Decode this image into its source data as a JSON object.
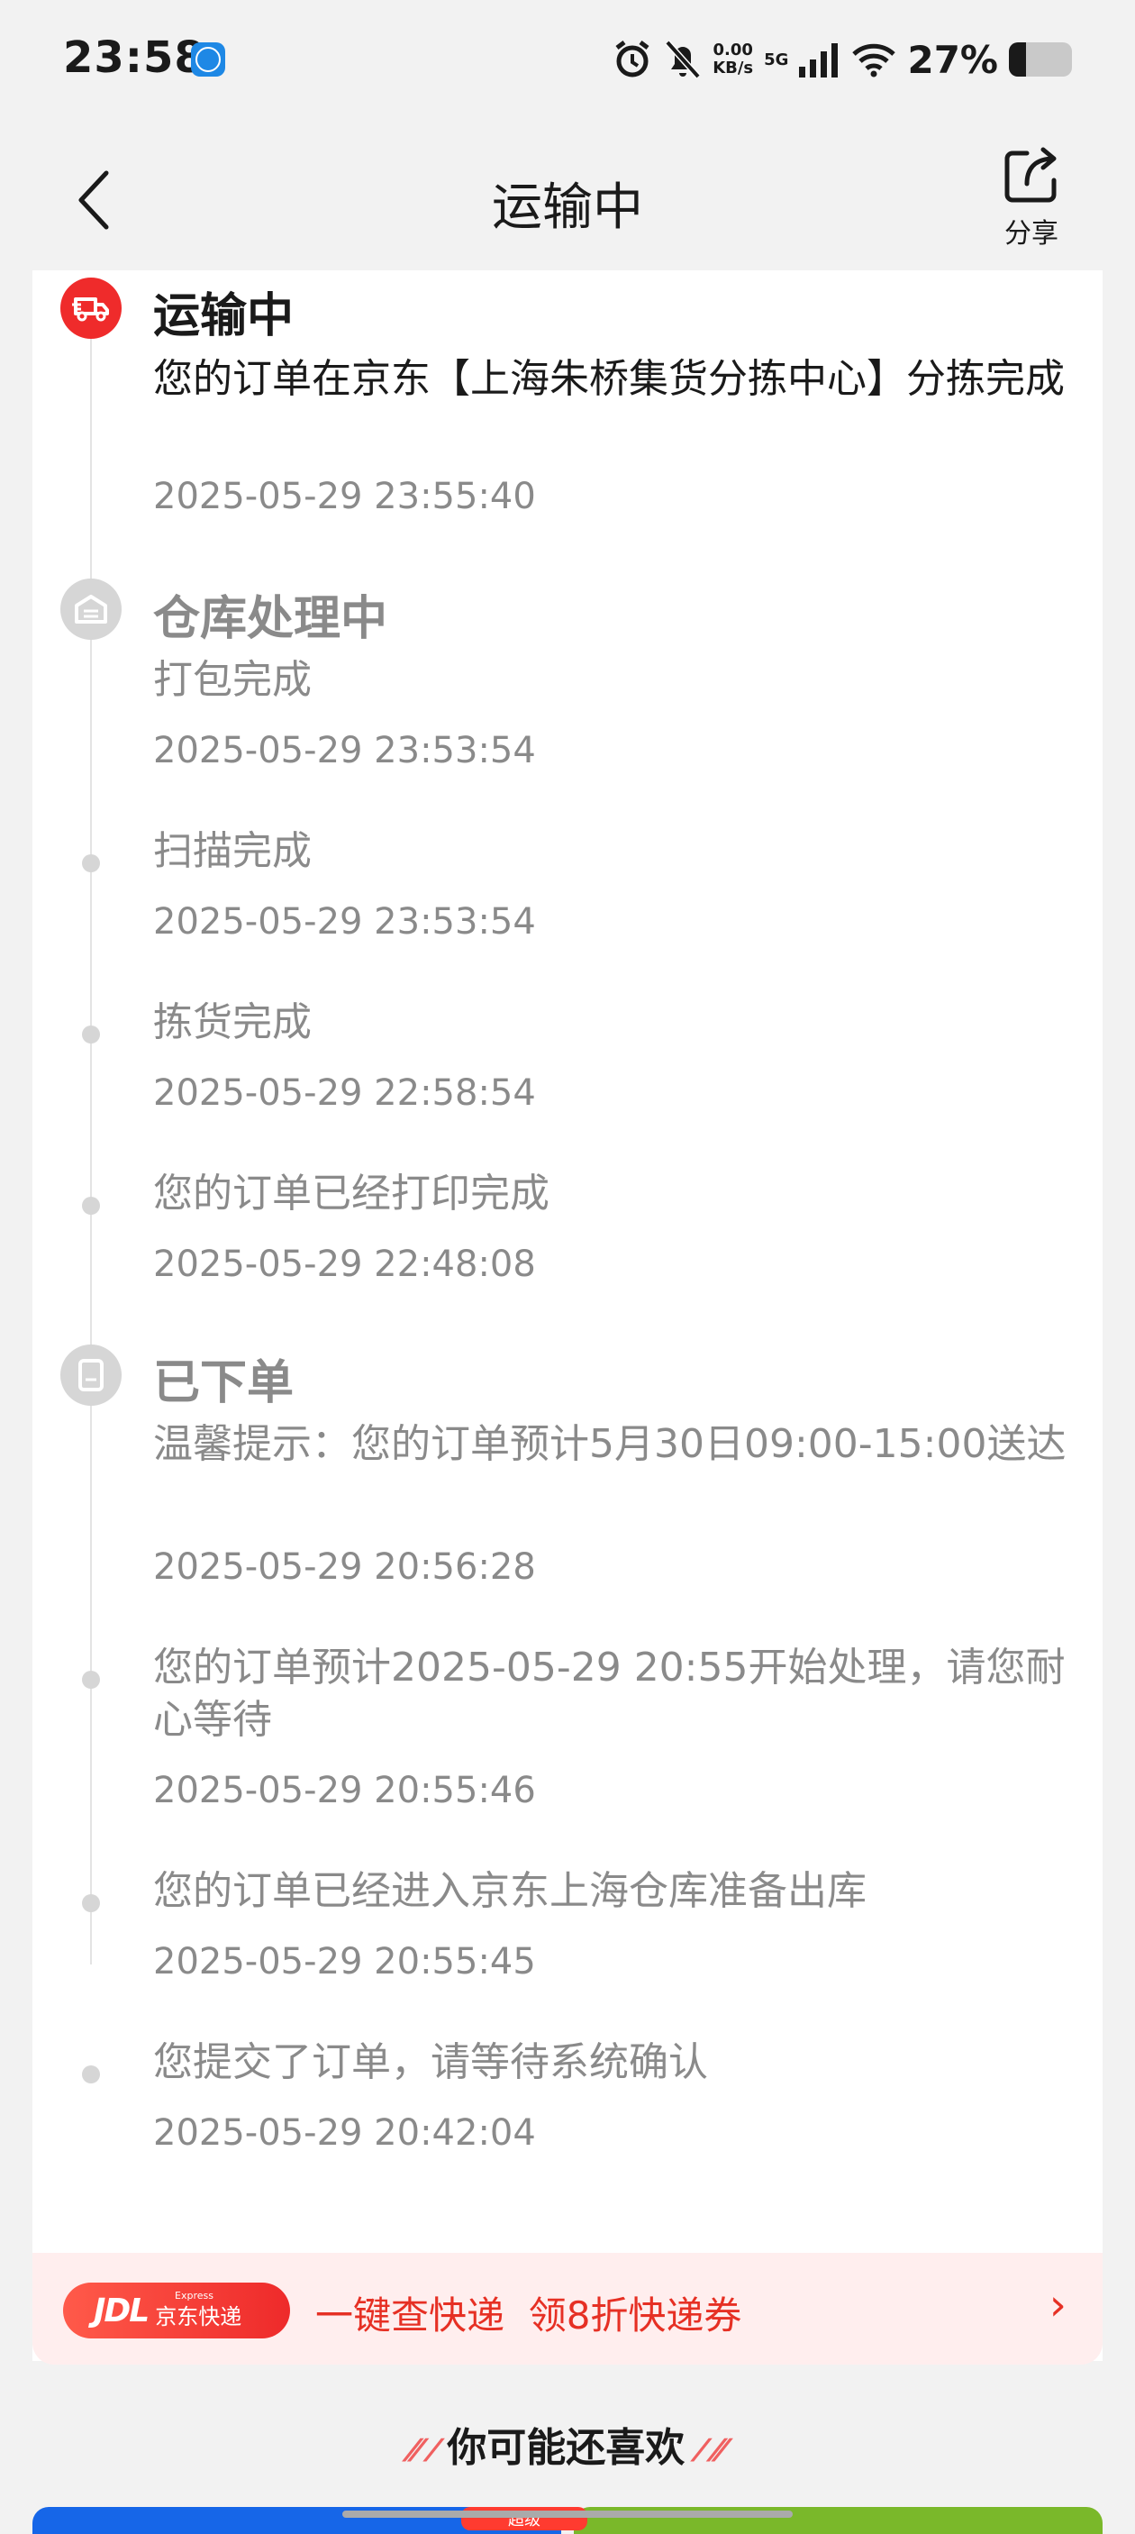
{
  "status_bar": {
    "time": "23:58",
    "app_badge": "K",
    "net_speed_value": "0.00",
    "net_speed_unit": "KB/s",
    "network": "5G",
    "battery_text": "27%",
    "battery_level": 0.27
  },
  "nav": {
    "title": "运输中",
    "share_label": "分享"
  },
  "timeline": {
    "stage_transit": {
      "title": "运输中",
      "event": {
        "desc": "您的订单在京东【上海朱桥集货分拣中心】分拣完成",
        "time": "2025-05-29 23:55:40"
      }
    },
    "stage_warehouse": {
      "title": "仓库处理中",
      "events": [
        {
          "desc": "打包完成",
          "time": "2025-05-29 23:53:54"
        },
        {
          "desc": "扫描完成",
          "time": "2025-05-29 23:53:54"
        },
        {
          "desc": "拣货完成",
          "time": "2025-05-29 22:58:54"
        },
        {
          "desc": "您的订单已经打印完成",
          "time": "2025-05-29 22:48:08"
        }
      ]
    },
    "stage_ordered": {
      "title": "已下单",
      "events": [
        {
          "desc": "温馨提示：您的订单预计5月30日09:00-15:00送达",
          "time": "2025-05-29 20:56:28"
        },
        {
          "desc": "您的订单预计2025-05-29 20:55开始处理，请您耐心等待",
          "time": "2025-05-29 20:55:46"
        },
        {
          "desc": "您的订单已经进入京东上海仓库准备出库",
          "time": "2025-05-29 20:55:45"
        },
        {
          "desc": "您提交了订单，请等待系统确认",
          "time": "2025-05-29 20:42:04"
        }
      ]
    }
  },
  "promo": {
    "badge_logo": "JDL",
    "badge_sub": "Express",
    "badge_cn": "京东快递",
    "text": "一键查快递  领8折快递券",
    "arrow": "›"
  },
  "recommend": {
    "title": "你可能还喜欢",
    "badge": "超级"
  },
  "colors": {
    "accent_red": "#ef2b2b",
    "promo_text": "#e63024",
    "inactive_text": "#8a8a8a"
  }
}
